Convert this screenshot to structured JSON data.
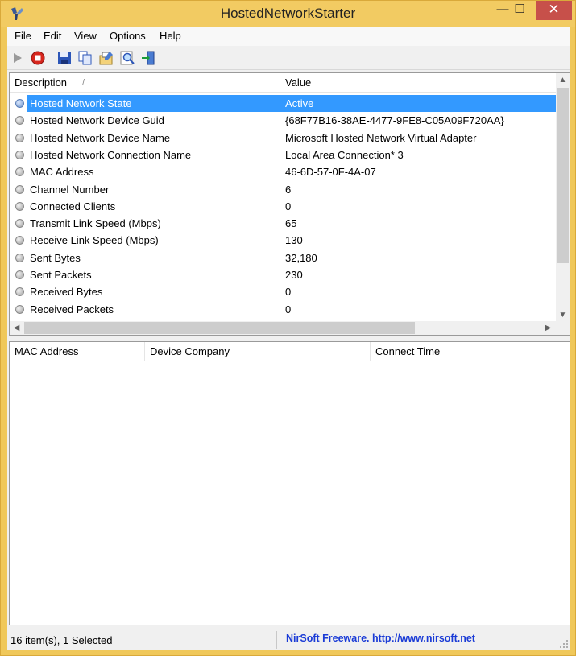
{
  "window": {
    "title": "HostedNetworkStarter",
    "minimize_glyph": "—",
    "maximize_glyph": "☐",
    "close_glyph": "✕"
  },
  "menu": [
    "File",
    "Edit",
    "View",
    "Options",
    "Help"
  ],
  "toolbar": {
    "icons": [
      "start-icon",
      "stop-icon",
      "save-icon",
      "copy-icon",
      "properties-icon",
      "find-icon",
      "exit-icon"
    ]
  },
  "top_table": {
    "columns": [
      "Description",
      "Value"
    ],
    "sort_glyph": "/",
    "rows": [
      {
        "description": "Hosted Network State",
        "value": "Active",
        "selected": true
      },
      {
        "description": "Hosted Network Device Guid",
        "value": "{68F77B16-38AE-4477-9FE8-C05A09F720AA}"
      },
      {
        "description": "Hosted Network Device Name",
        "value": "Microsoft Hosted Network Virtual Adapter"
      },
      {
        "description": "Hosted Network Connection Name",
        "value": "Local Area Connection* 3"
      },
      {
        "description": "MAC Address",
        "value": "46-6D-57-0F-4A-07"
      },
      {
        "description": "Channel Number",
        "value": "6"
      },
      {
        "description": "Connected Clients",
        "value": "0"
      },
      {
        "description": "Transmit Link Speed (Mbps)",
        "value": "65"
      },
      {
        "description": "Receive Link Speed (Mbps)",
        "value": "130"
      },
      {
        "description": "Sent Bytes",
        "value": "32,180"
      },
      {
        "description": "Sent Packets",
        "value": "230"
      },
      {
        "description": "Received Bytes",
        "value": "0"
      },
      {
        "description": "Received Packets",
        "value": "0"
      }
    ]
  },
  "bottom_table": {
    "columns": [
      "MAC Address",
      "Device Company",
      "Connect Time"
    ]
  },
  "status": {
    "items_text": "16 item(s), 1 Selected",
    "credit_text": "NirSoft Freeware.  http://www.nirsoft.net"
  },
  "colors": {
    "title_bar": "#f2cb62",
    "selection": "#3399ff",
    "close_button": "#c7504a",
    "link": "#1a3bd6"
  }
}
